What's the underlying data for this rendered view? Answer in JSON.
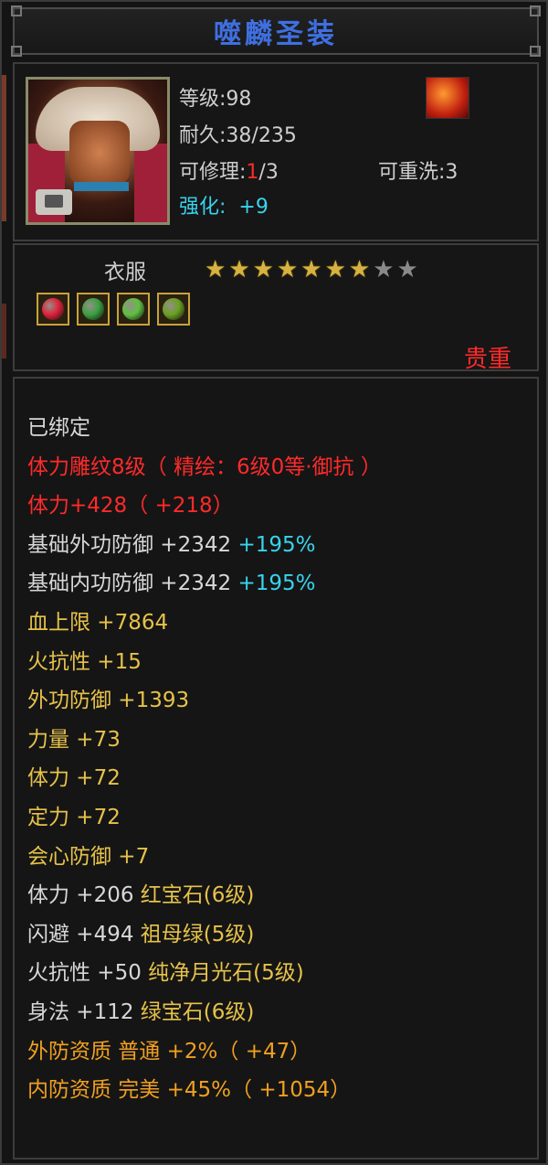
{
  "title": "噬麟圣装",
  "header": {
    "level_label": "等级:98",
    "durability_label": "耐久:38/235",
    "repair_prefix": "可修理:",
    "repair_current": "1",
    "repair_suffix": "/3",
    "rewash_label": "可重洗:3",
    "enhance_label": "强化:",
    "enhance_value": "+9"
  },
  "item": {
    "type_label": "衣服",
    "stars_filled": 7,
    "stars_total": 9,
    "quality": "贵重",
    "gems": [
      {
        "icon": "ruby-gem-icon",
        "color": "#e0203a"
      },
      {
        "icon": "emerald-gem-icon",
        "color": "#3aa040"
      },
      {
        "icon": "jade-gem-icon",
        "color": "#5fc040"
      },
      {
        "icon": "moonstone-gem-icon",
        "color": "#6aa020"
      }
    ]
  },
  "stats": [
    {
      "parts": [
        {
          "text": "已绑定",
          "color": "#d8d8d8"
        }
      ]
    },
    {
      "parts": [
        {
          "text": "体力雕纹8级（ 精绘：6级0等·御抗 ）",
          "color": "#ff2a2a"
        }
      ]
    },
    {
      "parts": [
        {
          "text": "体力+428（ +218）",
          "color": "#ff2a2a"
        }
      ]
    },
    {
      "parts": [
        {
          "text": "基础外功防御 +2342 ",
          "color": "#d8d8d8"
        },
        {
          "text": "+195%",
          "color": "#39d3ee"
        }
      ]
    },
    {
      "parts": [
        {
          "text": "基础内功防御 +2342 ",
          "color": "#d8d8d8"
        },
        {
          "text": "+195%",
          "color": "#39d3ee"
        }
      ]
    },
    {
      "parts": [
        {
          "text": "血上限 +7864",
          "color": "#e6c24a"
        }
      ]
    },
    {
      "parts": [
        {
          "text": "火抗性 +15",
          "color": "#e6c24a"
        }
      ]
    },
    {
      "parts": [
        {
          "text": "外功防御 +1393",
          "color": "#e6c24a"
        }
      ]
    },
    {
      "parts": [
        {
          "text": "力量 +73",
          "color": "#e6c24a"
        }
      ]
    },
    {
      "parts": [
        {
          "text": "体力 +72",
          "color": "#e6c24a"
        }
      ]
    },
    {
      "parts": [
        {
          "text": "定力 +72",
          "color": "#e6c24a"
        }
      ]
    },
    {
      "parts": [
        {
          "text": "会心防御 +7",
          "color": "#e6c24a"
        }
      ]
    },
    {
      "parts": [
        {
          "text": "体力 +206 ",
          "color": "#d8d8d8"
        },
        {
          "text": "红宝石(6级)",
          "color": "#e6c24a"
        }
      ]
    },
    {
      "parts": [
        {
          "text": "闪避 +494 ",
          "color": "#d8d8d8"
        },
        {
          "text": "祖母绿(5级)",
          "color": "#e6c24a"
        }
      ]
    },
    {
      "parts": [
        {
          "text": "火抗性 +50 ",
          "color": "#d8d8d8"
        },
        {
          "text": "纯净月光石(5级)",
          "color": "#e6c24a"
        }
      ]
    },
    {
      "parts": [
        {
          "text": "身法 +112 ",
          "color": "#d8d8d8"
        },
        {
          "text": "绿宝石(6级)",
          "color": "#e6c24a"
        }
      ]
    },
    {
      "parts": [
        {
          "text": "外防资质  普通 +2%（ +47）",
          "color": "#f0a020"
        }
      ]
    },
    {
      "parts": [
        {
          "text": "内防资质  完美 +45%（ +1054）",
          "color": "#f0a020"
        }
      ]
    }
  ],
  "colors": {
    "title": "#3f6fe0",
    "red": "#ff2a2a",
    "cyan": "#39d3ee",
    "gold": "#e6c24a",
    "orange": "#f0a020"
  }
}
